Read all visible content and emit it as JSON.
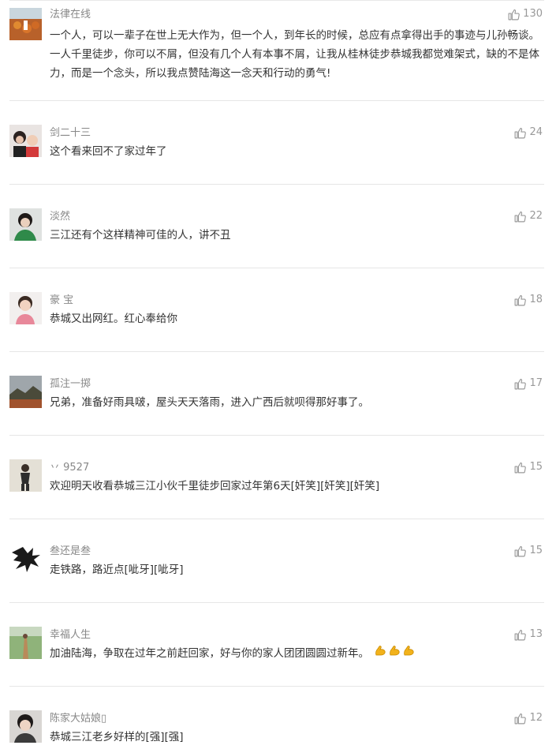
{
  "comments": [
    {
      "user": "法律在线",
      "text": "一个人，可以一辈子在世上无大作为，但一个人，到年长的时候，总应有点拿得出手的事迹与儿孙畅谈。一人千里徒步，你可以不屑，但没有几个人有本事不屑，让我从桂林徒步恭城我都觉难架式，缺的不是体力，而是一个念头，所以我点赞陆海这一念天和行动的勇气!",
      "likes": "130"
    },
    {
      "user": "剑二十三",
      "text": "这个看来回不了家过年了",
      "likes": "24"
    },
    {
      "user": "淡然",
      "text": "三江还有个这样精神可佳的人，讲不丑",
      "likes": "22"
    },
    {
      "user": "豪 宝",
      "text": "恭城又出网红。红心奉给你",
      "likes": "18"
    },
    {
      "user": "孤注一掷",
      "text": "兄弟，准备好雨具啵，屋头天天落雨，进入广西后就呗得那好事了。",
      "likes": "17"
    },
    {
      "user": "丷 9527",
      "text": "欢迎明天收看恭城三江小伙千里徒步回家过年第6天[奸笑][奸笑][奸笑]",
      "likes": "15"
    },
    {
      "user": "叁还是叁",
      "text": "走铁路，路近点[呲牙][呲牙]",
      "likes": "15"
    },
    {
      "user": "幸福人生",
      "text": "加油陆海，争取在过年之前赶回家，好与你的家人团团圆圆过新年。",
      "likes": "13",
      "emojis": [
        "strong-arm-emoji",
        "strong-arm-emoji",
        "strong-arm-emoji"
      ]
    },
    {
      "user": "陈家大姑娘▯",
      "text": "恭城三江老乡好样的[强][强]",
      "likes": "12"
    }
  ],
  "colors": {
    "username": "#888888",
    "text": "#333333",
    "likes": "#999999",
    "divider": "#e6e6e6"
  },
  "icons": {
    "like": "thumbs-up-icon"
  }
}
